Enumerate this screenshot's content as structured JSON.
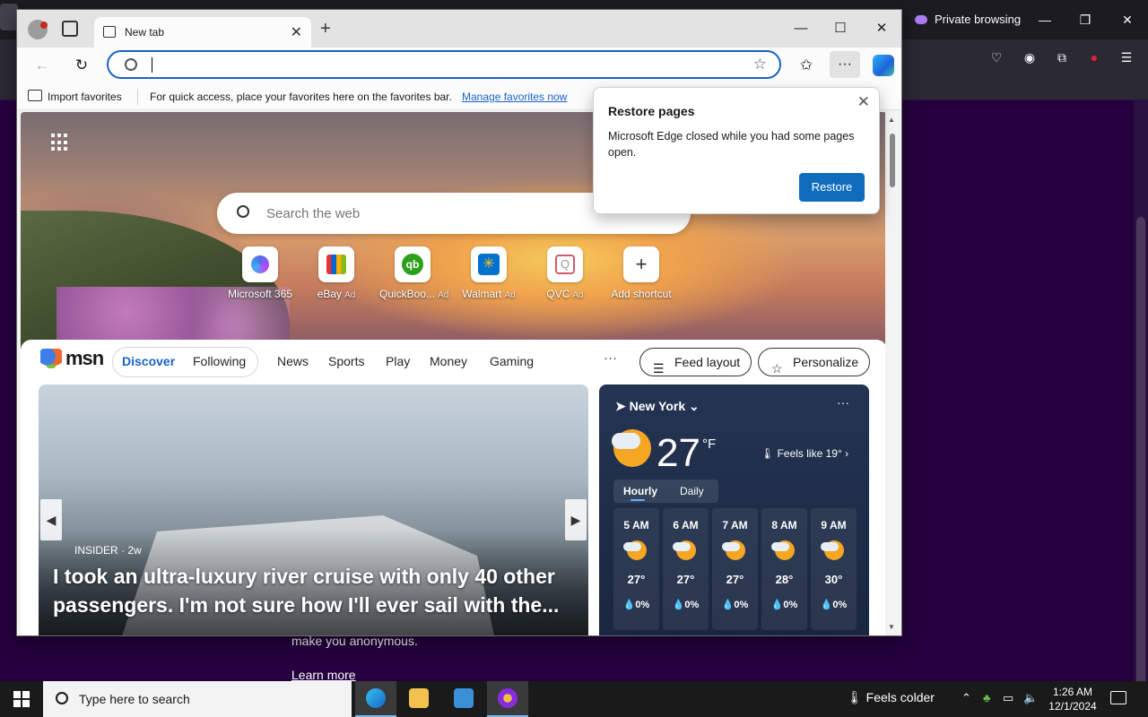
{
  "firefox": {
    "private_label": "Private browsing",
    "content_line1": "make you anonymous.",
    "learn_more": "Learn more"
  },
  "edge": {
    "tab_title": "New tab",
    "favbar": {
      "import_label": "Import favorites",
      "message": "For quick access, place your favorites here on the favorites bar.",
      "manage_link": "Manage favorites now"
    },
    "search_placeholder": "Search the web",
    "shortcuts": [
      {
        "label": "Microsoft 365",
        "ad": "",
        "icon": "microsoft-365-icon"
      },
      {
        "label": "eBay",
        "ad": "Ad",
        "icon": "ebay-icon"
      },
      {
        "label": "QuickBoo...",
        "ad": "Ad",
        "icon": "quickbooks-icon"
      },
      {
        "label": "Walmart",
        "ad": "Ad",
        "icon": "walmart-icon"
      },
      {
        "label": "QVC",
        "ad": "Ad",
        "icon": "qvc-icon"
      },
      {
        "label": "Add shortcut",
        "ad": "",
        "icon": "plus-icon"
      }
    ],
    "restore_popup": {
      "title": "Restore pages",
      "body": "Microsoft Edge closed while you had some pages open.",
      "button": "Restore"
    }
  },
  "feed": {
    "brand": "msn",
    "tabs": {
      "discover": "Discover",
      "following": "Following"
    },
    "nav": [
      "News",
      "Sports",
      "Play",
      "Money",
      "Gaming"
    ],
    "more": "···",
    "feed_layout": "Feed layout",
    "personalize": "Personalize",
    "hero": {
      "source": "INSIDER · 2w",
      "title": "I took an ultra-luxury river cruise with only 40 other passengers. I'm not sure how I'll ever sail with the..."
    },
    "weather": {
      "location": "New York",
      "temp": "27",
      "unit": "°F",
      "feels_like": "Feels like 19°",
      "tab_hourly": "Hourly",
      "tab_daily": "Daily",
      "hours": [
        {
          "time": "5 AM",
          "temp": "27°",
          "precip": "0%"
        },
        {
          "time": "6 AM",
          "temp": "27°",
          "precip": "0%"
        },
        {
          "time": "7 AM",
          "temp": "27°",
          "precip": "0%"
        },
        {
          "time": "8 AM",
          "temp": "28°",
          "precip": "0%"
        },
        {
          "time": "9 AM",
          "temp": "30°",
          "precip": "0%"
        }
      ]
    }
  },
  "taskbar": {
    "search_placeholder": "Type here to search",
    "weather": "Feels colder",
    "time": "1:26 AM",
    "date": "12/1/2024"
  },
  "colors": {
    "accent": "#0f6cbd",
    "firefox_bg": "#25003e",
    "weather_bg": "#243453"
  }
}
